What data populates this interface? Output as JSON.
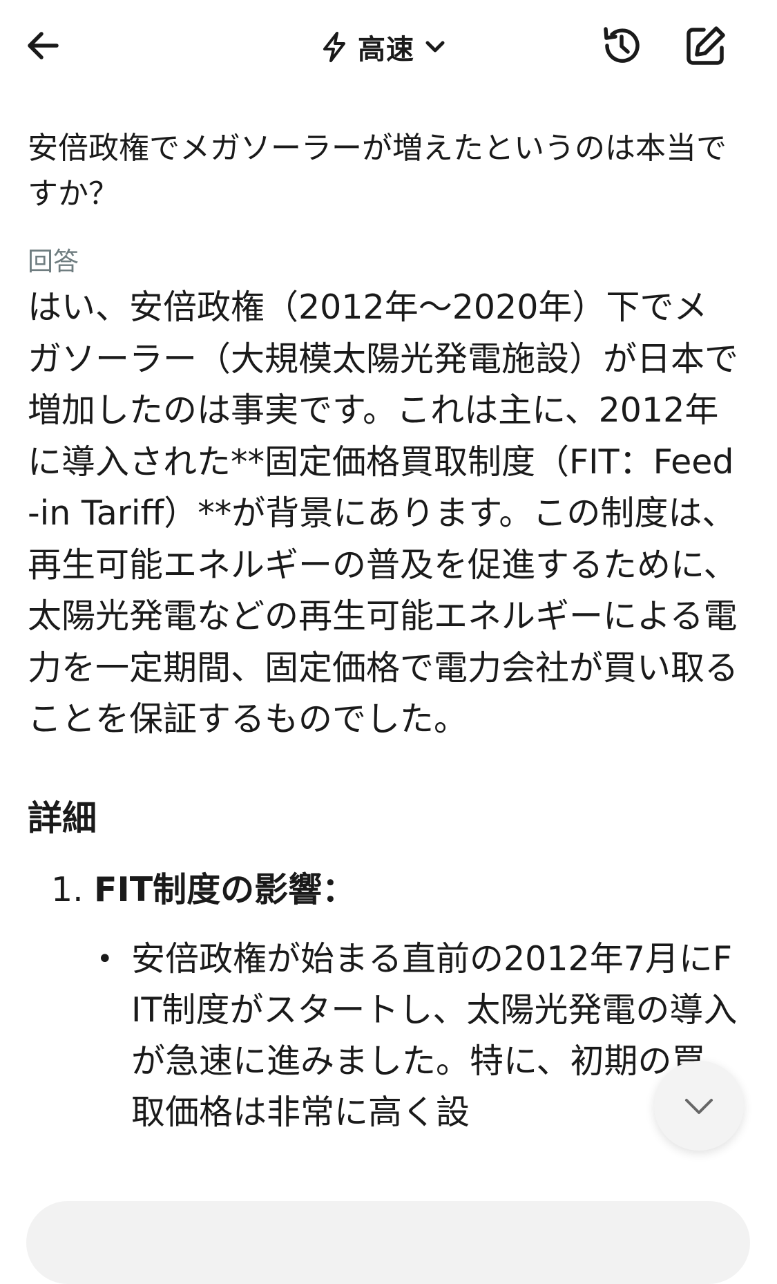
{
  "header": {
    "mode_label": "高速",
    "icons": {
      "back": "arrow-left-icon",
      "mode": "lightning-icon",
      "dropdown": "chevron-down-icon",
      "history": "history-icon",
      "new_chat": "edit-icon"
    }
  },
  "conversation": {
    "question": "安倍政権でメガソーラーが増えたというのは本当ですか？",
    "answer_label": "回答",
    "answer_text": "はい、安倍政権（2012年〜2020年）下でメガソーラー（大規模太陽光発電施設）が日本で増加したのは事実です。これは主に、2012年に導入された**固定価格買取制度（FIT：Feed-in Tariff）**が背景にあります。この制度は、再生可能エネルギーの普及を促進するために、太陽光発電などの再生可能エネルギーによる電力を一定期間、固定価格で電力会社が買い取ることを保証するものでした。",
    "details_heading": "詳細",
    "items": [
      {
        "number": "1.",
        "title": "FIT制度の影響：",
        "bullets": [
          "安倍政権が始まる直前の2012年7月にFIT制度がスタートし、太陽光発電の導入が急速に進みました。特に、初期の買取価格は非常に高く設"
        ]
      }
    ]
  },
  "controls": {
    "scroll_down_icon": "chevron-down-icon"
  }
}
